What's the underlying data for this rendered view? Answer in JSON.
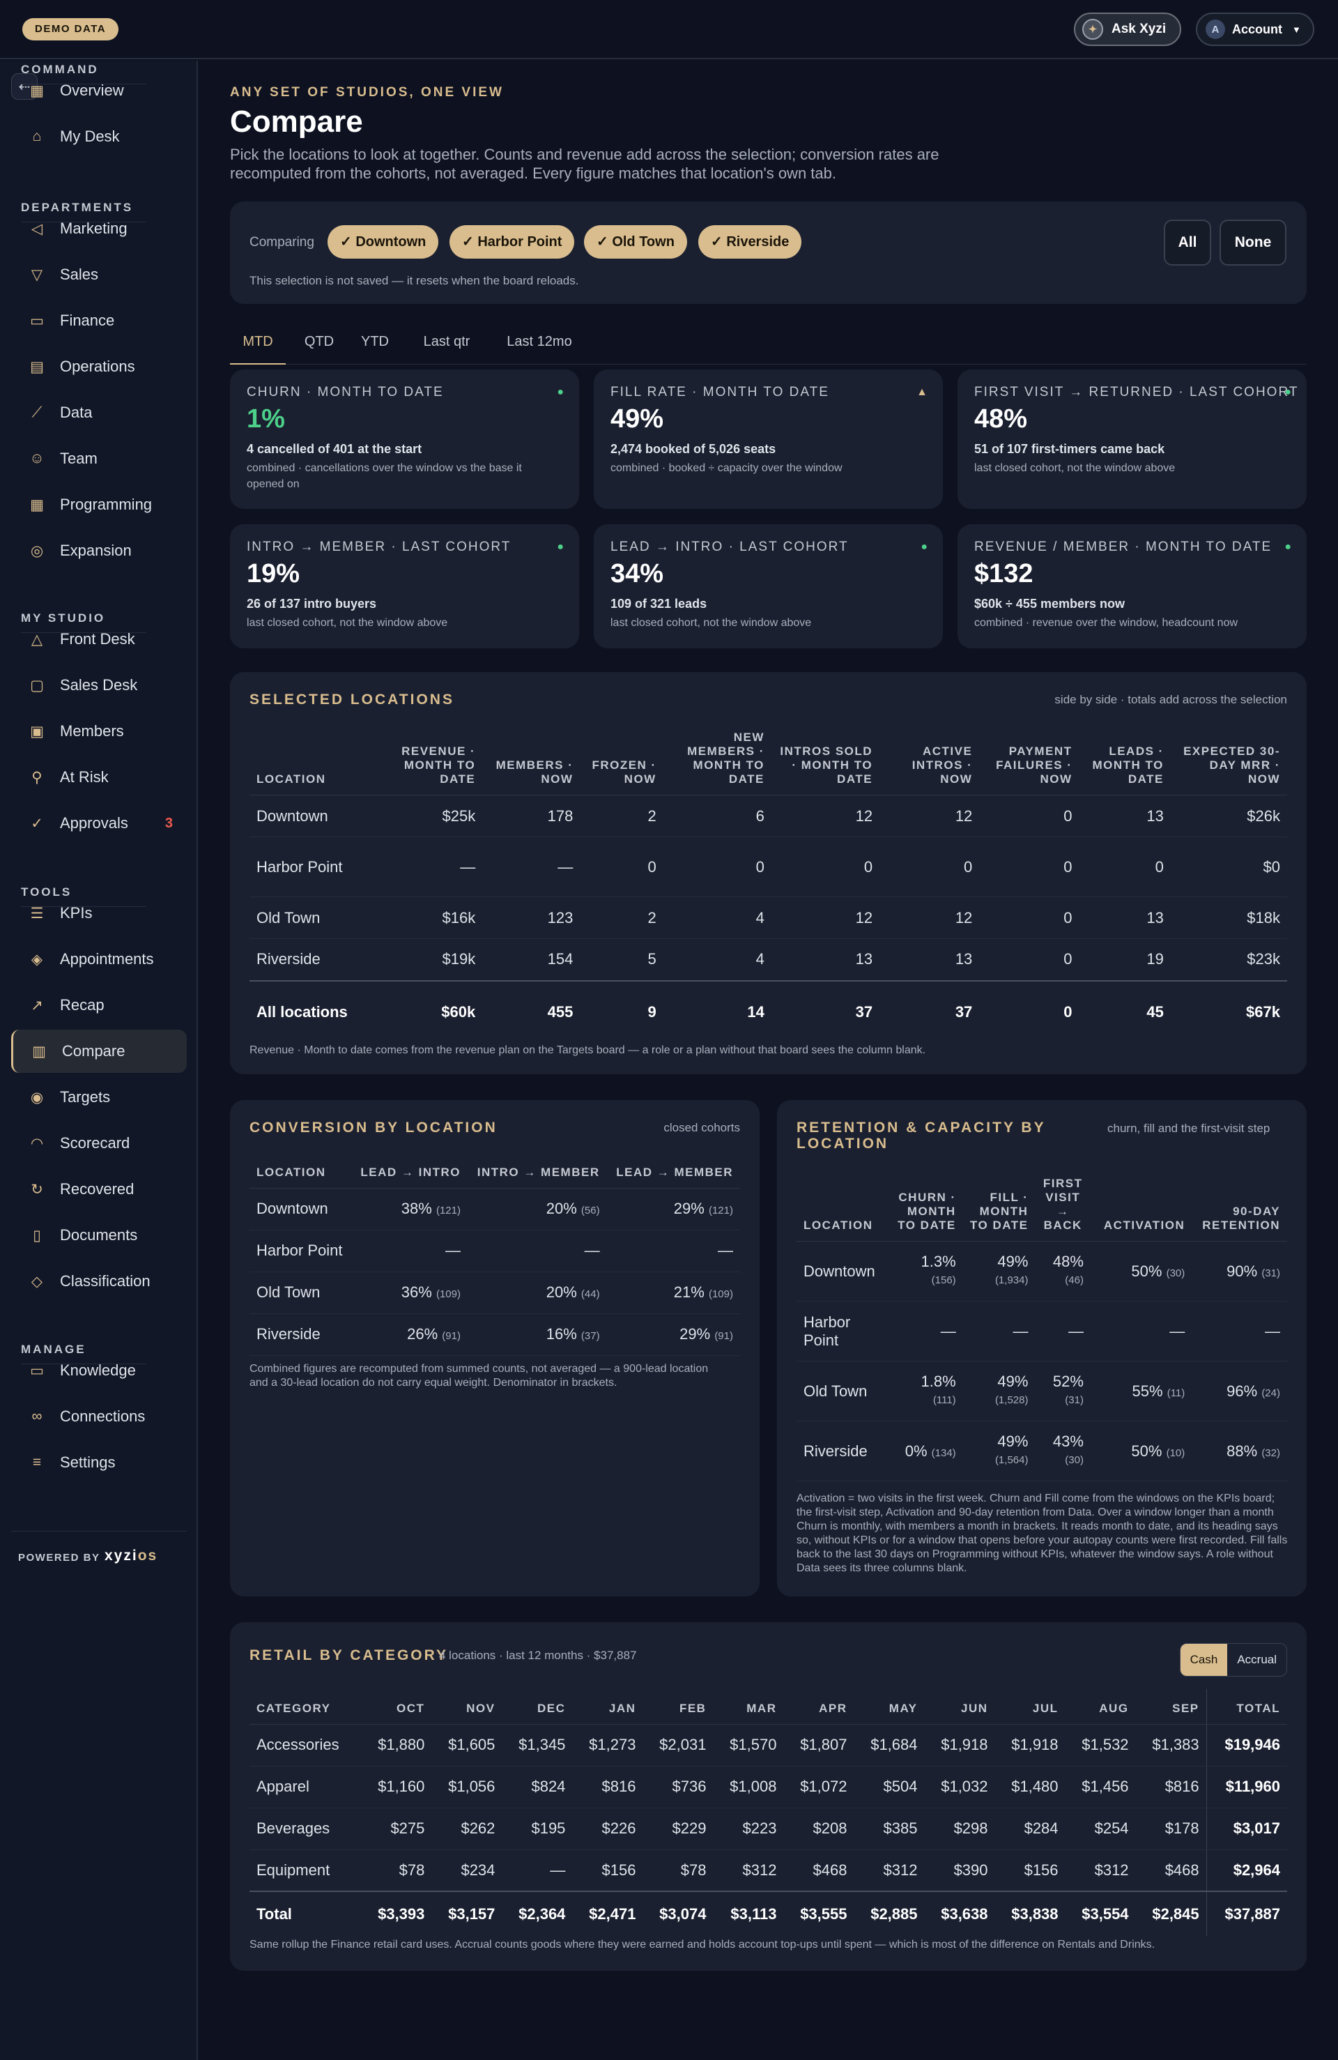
{
  "topbar": {
    "demo_badge": "DEMO DATA",
    "ask_label": "Ask Xyzi",
    "account_label": "Account",
    "account_initial": "A"
  },
  "sidebar": {
    "sections": [
      {
        "label": "COMMAND",
        "items": [
          {
            "label": "Overview",
            "icon": "grid-icon"
          },
          {
            "label": "My Desk",
            "icon": "inbox-icon"
          }
        ]
      },
      {
        "label": "DEPARTMENTS",
        "items": [
          {
            "label": "Marketing",
            "icon": "megaphone-icon"
          },
          {
            "label": "Sales",
            "icon": "funnel-icon"
          },
          {
            "label": "Finance",
            "icon": "cash-icon"
          },
          {
            "label": "Operations",
            "icon": "clipboard-icon"
          },
          {
            "label": "Data",
            "icon": "line-chart-icon"
          },
          {
            "label": "Team",
            "icon": "people-icon"
          },
          {
            "label": "Programming",
            "icon": "calendar-icon"
          },
          {
            "label": "Expansion",
            "icon": "compass-icon"
          }
        ]
      },
      {
        "label": "MY STUDIO",
        "items": [
          {
            "label": "Front Desk",
            "icon": "bell-icon"
          },
          {
            "label": "Sales Desk",
            "icon": "chat-icon"
          },
          {
            "label": "Members",
            "icon": "id-card-icon"
          },
          {
            "label": "At Risk",
            "icon": "user-alert-icon"
          },
          {
            "label": "Approvals",
            "icon": "check-circle-icon",
            "badge": "3"
          }
        ]
      },
      {
        "label": "TOOLS",
        "items": [
          {
            "label": "KPIs",
            "icon": "sliders-icon"
          },
          {
            "label": "Appointments",
            "icon": "layers-icon"
          },
          {
            "label": "Recap",
            "icon": "trend-icon"
          },
          {
            "label": "Compare",
            "icon": "bar-chart-icon",
            "active": true
          },
          {
            "label": "Targets",
            "icon": "target-icon"
          },
          {
            "label": "Scorecard",
            "icon": "gauge-icon"
          },
          {
            "label": "Recovered",
            "icon": "refresh-icon"
          },
          {
            "label": "Documents",
            "icon": "document-icon"
          },
          {
            "label": "Classification",
            "icon": "tag-icon"
          }
        ]
      },
      {
        "label": "MANAGE",
        "items": [
          {
            "label": "Knowledge",
            "icon": "book-icon"
          },
          {
            "label": "Connections",
            "icon": "link-icon"
          },
          {
            "label": "Settings",
            "icon": "settings-icon"
          }
        ]
      }
    ],
    "powered_by": "POWERED BY",
    "brand_a": "xyzi",
    "brand_b": "os"
  },
  "header": {
    "eyebrow": "ANY SET OF STUDIOS, ONE VIEW",
    "title": "Compare",
    "description": "Pick the locations to look at together. Counts and revenue add across the selection; conversion rates are recomputed from the cohorts, not averaged. Every figure matches that location's own tab."
  },
  "selection": {
    "label": "Comparing",
    "chips": [
      "✓ Downtown",
      "✓ Harbor Point",
      "✓ Old Town",
      "✓ Riverside"
    ],
    "all_label": "All",
    "none_label": "None",
    "note": "This selection is not saved — it resets when the board reloads."
  },
  "periods": {
    "tabs": [
      "MTD",
      "QTD",
      "YTD",
      "Last qtr",
      "Last 12mo"
    ],
    "active": "MTD"
  },
  "kpis": [
    {
      "label": "CHURN · MONTH TO DATE",
      "value": "1%",
      "detail": "4 cancelled of 401 at the start",
      "note": "combined · cancellations over the window vs the base it opened on",
      "indicator": "green-dot",
      "value_color": "#4cd08a"
    },
    {
      "label": "FILL RATE · MONTH TO DATE",
      "value": "49%",
      "detail": "2,474 booked of 5,026 seats",
      "note": "combined · booked ÷ capacity over the window",
      "indicator": "up-triangle",
      "value_color": "#ffffff"
    },
    {
      "label": "FIRST VISIT → RETURNED · LAST COHORT",
      "value": "48%",
      "detail": "51 of 107 first-timers came back",
      "note": "last closed cohort, not the window above",
      "indicator": "green-dot",
      "value_color": "#ffffff"
    },
    {
      "label": "INTRO → MEMBER · LAST COHORT",
      "value": "19%",
      "detail": "26 of 137 intro buyers",
      "note": "last closed cohort, not the window above",
      "indicator": "green-dot",
      "value_color": "#ffffff"
    },
    {
      "label": "LEAD → INTRO · LAST COHORT",
      "value": "34%",
      "detail": "109 of 321 leads",
      "note": "last closed cohort, not the window above",
      "indicator": "green-dot",
      "value_color": "#ffffff"
    },
    {
      "label": "REVENUE / MEMBER · MONTH TO DATE",
      "value": "$132",
      "detail": "$60k ÷ 455 members now",
      "note": "combined · revenue over the window, headcount now",
      "indicator": "green-dot",
      "value_color": "#ffffff"
    }
  ],
  "selected_locations": {
    "title": "SELECTED LOCATIONS",
    "side": "side by side · totals add across the selection",
    "columns": [
      "LOCATION",
      "REVENUE · MONTH TO DATE",
      "MEMBERS · NOW",
      "FROZEN · NOW",
      "NEW MEMBERS · MONTH TO DATE",
      "INTROS SOLD · MONTH TO DATE",
      "ACTIVE INTROS · NOW",
      "PAYMENT FAILURES · NOW",
      "LEADS · MONTH TO DATE",
      "EXPECTED 30-DAY MRR · NOW"
    ],
    "rows": [
      [
        "Downtown",
        "$25k",
        "178",
        "2",
        "6",
        "12",
        "12",
        "0",
        "13",
        "$26k"
      ],
      [
        "Harbor Point",
        "—",
        "—",
        "0",
        "0",
        "0",
        "0",
        "0",
        "0",
        "$0"
      ],
      [
        "Old Town",
        "$16k",
        "123",
        "2",
        "4",
        "12",
        "12",
        "0",
        "13",
        "$18k"
      ],
      [
        "Riverside",
        "$19k",
        "154",
        "5",
        "4",
        "13",
        "13",
        "0",
        "19",
        "$23k"
      ]
    ],
    "total": [
      "All locations",
      "$60k",
      "455",
      "9",
      "14",
      "37",
      "37",
      "0",
      "45",
      "$67k"
    ],
    "note": "Revenue · Month to date comes from the revenue plan on the Targets board — a role or a plan without that board sees the column blank."
  },
  "conversion": {
    "title": "CONVERSION BY LOCATION",
    "side": "closed cohorts",
    "columns": [
      "LOCATION",
      "LEAD → INTRO",
      "INTRO → MEMBER",
      "LEAD → MEMBER"
    ],
    "rows": [
      {
        "loc": "Downtown",
        "cells": [
          {
            "v": "38%",
            "n": "(121)"
          },
          {
            "v": "20%",
            "n": "(56)"
          },
          {
            "v": "29%",
            "n": "(121)"
          }
        ]
      },
      {
        "loc": "Harbor Point",
        "cells": [
          {
            "v": "—",
            "n": ""
          },
          {
            "v": "—",
            "n": ""
          },
          {
            "v": "—",
            "n": ""
          }
        ]
      },
      {
        "loc": "Old Town",
        "cells": [
          {
            "v": "36%",
            "n": "(109)"
          },
          {
            "v": "20%",
            "n": "(44)"
          },
          {
            "v": "21%",
            "n": "(109)"
          }
        ]
      },
      {
        "loc": "Riverside",
        "cells": [
          {
            "v": "26%",
            "n": "(91)"
          },
          {
            "v": "16%",
            "n": "(37)"
          },
          {
            "v": "29%",
            "n": "(91)"
          }
        ]
      }
    ],
    "note": "Combined figures are recomputed from summed counts, not averaged — a 900-lead location and a 30-lead location do not carry equal weight. Denominator in brackets."
  },
  "retention": {
    "title": "RETENTION & CAPACITY BY LOCATION",
    "side": "churn, fill and the first-visit step",
    "columns": [
      "LOCATION",
      "CHURN · MONTH TO DATE",
      "FILL · MONTH TO DATE",
      "FIRST VISIT → BACK",
      "ACTIVATION",
      "90-DAY RETENTION"
    ],
    "rows": [
      {
        "loc": "Downtown",
        "cells": [
          {
            "v": "1.3%",
            "n": "(156)",
            "stack": true
          },
          {
            "v": "49%",
            "n": "(1,934)",
            "stack": true
          },
          {
            "v": "48%",
            "n": "(46)",
            "stack": true
          },
          {
            "v": "50%",
            "n": "(30)"
          },
          {
            "v": "90%",
            "n": "(31)"
          }
        ]
      },
      {
        "loc": "Harbor Point",
        "cells": [
          {
            "v": "—",
            "n": ""
          },
          {
            "v": "—",
            "n": ""
          },
          {
            "v": "—",
            "n": ""
          },
          {
            "v": "—",
            "n": ""
          },
          {
            "v": "—",
            "n": ""
          }
        ]
      },
      {
        "loc": "Old Town",
        "cells": [
          {
            "v": "1.8%",
            "n": "(111)",
            "stack": true
          },
          {
            "v": "49%",
            "n": "(1,528)",
            "stack": true
          },
          {
            "v": "52%",
            "n": "(31)",
            "stack": true
          },
          {
            "v": "55%",
            "n": "(11)"
          },
          {
            "v": "96%",
            "n": "(24)"
          }
        ]
      },
      {
        "loc": "Riverside",
        "cells": [
          {
            "v": "0%",
            "n": "(134)"
          },
          {
            "v": "49%",
            "n": "(1,564)",
            "stack": true
          },
          {
            "v": "43%",
            "n": "(30)",
            "stack": true
          },
          {
            "v": "50%",
            "n": "(10)"
          },
          {
            "v": "88%",
            "n": "(32)"
          }
        ]
      }
    ],
    "note": "Activation = two visits in the first week. Churn and Fill come from the windows on the KPIs board; the first-visit step, Activation and 90-day retention from Data. Over a window longer than a month Churn is monthly, with members a month in brackets. It reads month to date, and its heading says so, without KPIs or for a window that opens before your autopay counts were first recorded. Fill falls back to the last 30 days on Programming without KPIs, whatever the window says. A role without Data sees its three columns blank."
  },
  "retail": {
    "title": "RETAIL BY CATEGORY",
    "sub": "4 locations · last 12 months · $37,887",
    "toggle": [
      "Cash",
      "Accrual"
    ],
    "toggle_active": "Cash",
    "columns": [
      "CATEGORY",
      "OCT",
      "NOV",
      "DEC",
      "JAN",
      "FEB",
      "MAR",
      "APR",
      "MAY",
      "JUN",
      "JUL",
      "AUG",
      "SEP",
      "TOTAL"
    ],
    "rows": [
      [
        "Accessories",
        "$1,880",
        "$1,605",
        "$1,345",
        "$1,273",
        "$2,031",
        "$1,570",
        "$1,807",
        "$1,684",
        "$1,918",
        "$1,918",
        "$1,532",
        "$1,383",
        "$19,946"
      ],
      [
        "Apparel",
        "$1,160",
        "$1,056",
        "$824",
        "$816",
        "$736",
        "$1,008",
        "$1,072",
        "$504",
        "$1,032",
        "$1,480",
        "$1,456",
        "$816",
        "$11,960"
      ],
      [
        "Beverages",
        "$275",
        "$262",
        "$195",
        "$226",
        "$229",
        "$223",
        "$208",
        "$385",
        "$298",
        "$284",
        "$254",
        "$178",
        "$3,017"
      ],
      [
        "Equipment",
        "$78",
        "$234",
        "—",
        "$156",
        "$78",
        "$312",
        "$468",
        "$312",
        "$390",
        "$156",
        "$312",
        "$468",
        "$2,964"
      ]
    ],
    "total": [
      "Total",
      "$3,393",
      "$3,157",
      "$2,364",
      "$2,471",
      "$3,074",
      "$3,113",
      "$3,555",
      "$2,885",
      "$3,638",
      "$3,838",
      "$3,554",
      "$2,845",
      "$37,887"
    ],
    "note": "Same rollup the Finance retail card uses. Accrual counts goods where they were earned and holds account top-ups until spent — which is most of the difference on Rentals and Drinks."
  },
  "colors": {
    "accent": "#d9bd8e",
    "positive": "#4cd08a",
    "badge": "#ef5b4d",
    "background": "#0e1220",
    "card": "#1b2030"
  }
}
